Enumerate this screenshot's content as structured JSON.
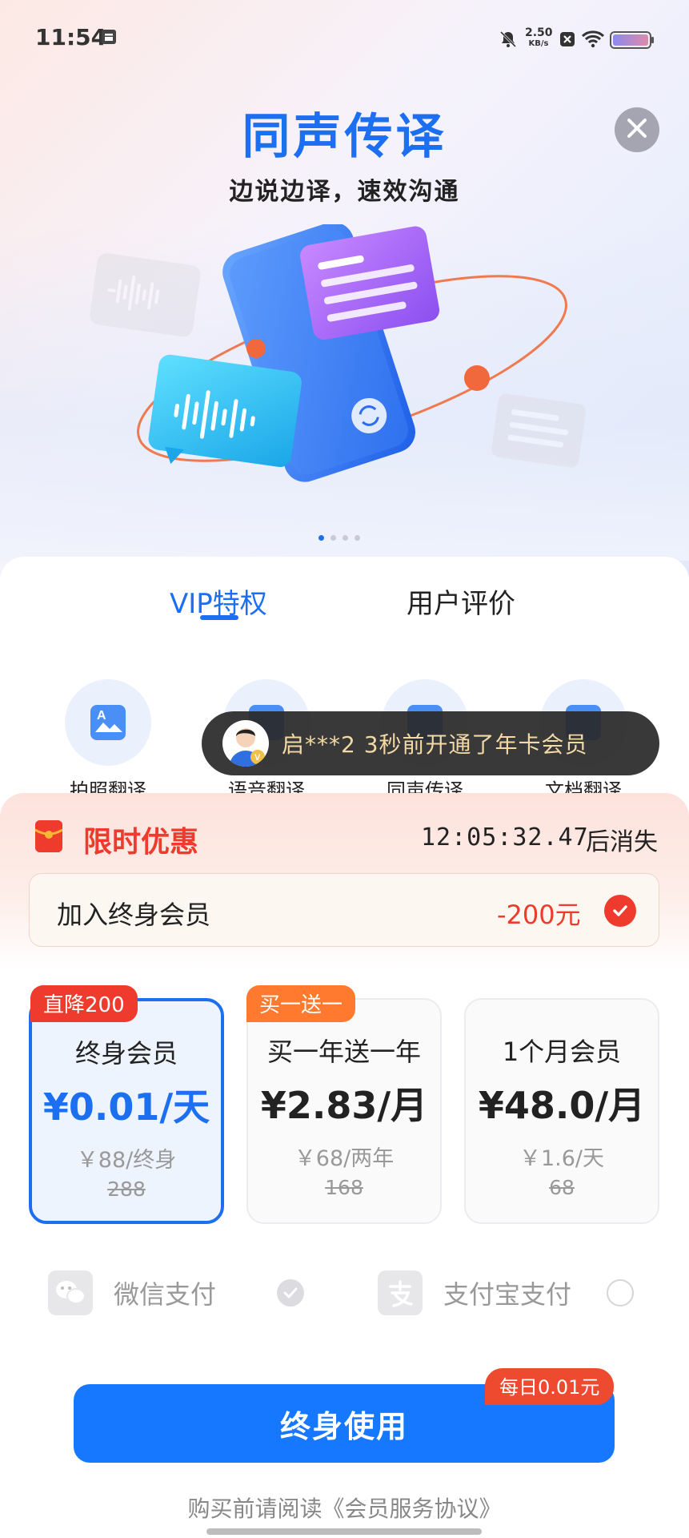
{
  "status_bar": {
    "time": "11:54",
    "net_speed_value": "2.50",
    "net_speed_unit": "KB/s"
  },
  "hero": {
    "title": "同声传译",
    "subtitle": "边说边译，速效沟通",
    "carousel_active_index": 1,
    "carousel_total": 4
  },
  "tabs": [
    {
      "label": "VIP特权",
      "active": true
    },
    {
      "label": "用户评价",
      "active": false
    }
  ],
  "features": [
    {
      "label": "拍照翻译",
      "icon": "photo-translate-icon"
    },
    {
      "label": "语音翻译",
      "icon": "voice-translate-icon"
    },
    {
      "label": "同声传译",
      "icon": "simultaneous-translate-icon"
    },
    {
      "label": "文档翻译",
      "icon": "document-translate-icon"
    }
  ],
  "toast": {
    "text": "启***2 3秒前开通了年卡会员"
  },
  "promo": {
    "title": "限时优惠",
    "countdown": "12:05:32.47",
    "countdown_suffix": "后消失",
    "addon_label": "加入终身会员",
    "addon_price": "-200元",
    "addon_checked": true
  },
  "plans": [
    {
      "badge": "直降200",
      "name": "终身会员",
      "price": "¥0.01/天",
      "sub": "￥88/终身",
      "original": "288",
      "selected": true
    },
    {
      "badge": "买一送一",
      "name": "买一年送一年",
      "price": "¥2.83/月",
      "sub": "￥68/两年",
      "original": "168",
      "selected": false
    },
    {
      "badge": "",
      "name": "1个月会员",
      "price": "¥48.0/月",
      "sub": "￥1.6/天",
      "original": "68",
      "selected": false
    }
  ],
  "payment": {
    "wechat_label": "微信支付",
    "wechat_selected": true,
    "alipay_label": "支付宝支付",
    "alipay_selected": false
  },
  "cta": {
    "label": "终身使用",
    "badge": "每日0.01元"
  },
  "agreement": "购买前请阅读《会员服务协议》",
  "colors": {
    "brand_blue": "#1d6ff2",
    "promo_red": "#ee3b2e",
    "cta_blue": "#1677ff"
  }
}
